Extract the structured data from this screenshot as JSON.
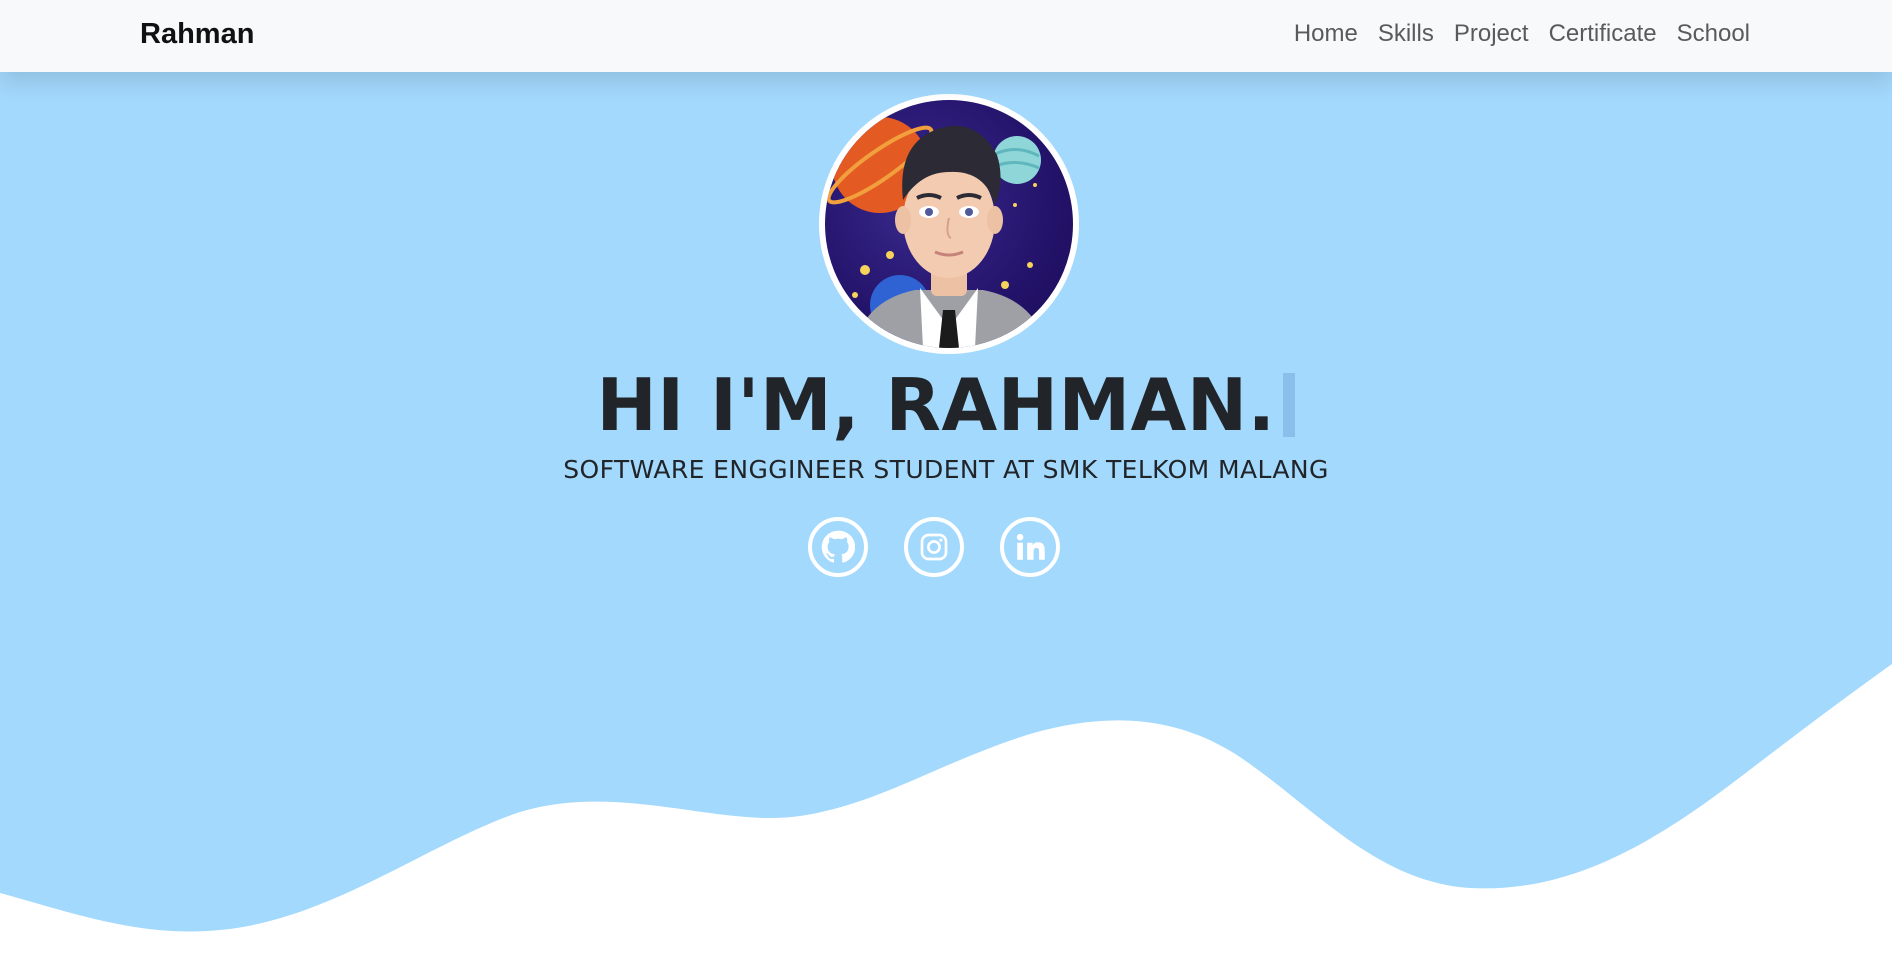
{
  "navbar": {
    "brand": "Rahman",
    "links": [
      {
        "label": "Home"
      },
      {
        "label": "Skills"
      },
      {
        "label": "Project"
      },
      {
        "label": "Certificate"
      },
      {
        "label": "School"
      }
    ]
  },
  "hero": {
    "title": "HI I'M, RAHMAN.",
    "subtitle": "SOFTWARE ENGGINEER STUDENT AT SMK TELKOM MALANG",
    "socials": [
      {
        "name": "github",
        "icon": "github-icon"
      },
      {
        "name": "instagram",
        "icon": "instagram-icon"
      },
      {
        "name": "linkedin",
        "icon": "linkedin-icon"
      }
    ]
  },
  "colors": {
    "hero_bg": "#a3d9fd",
    "navbar_bg": "#f8f9fa",
    "text_dark": "#212529",
    "wave": "#ffffff"
  }
}
